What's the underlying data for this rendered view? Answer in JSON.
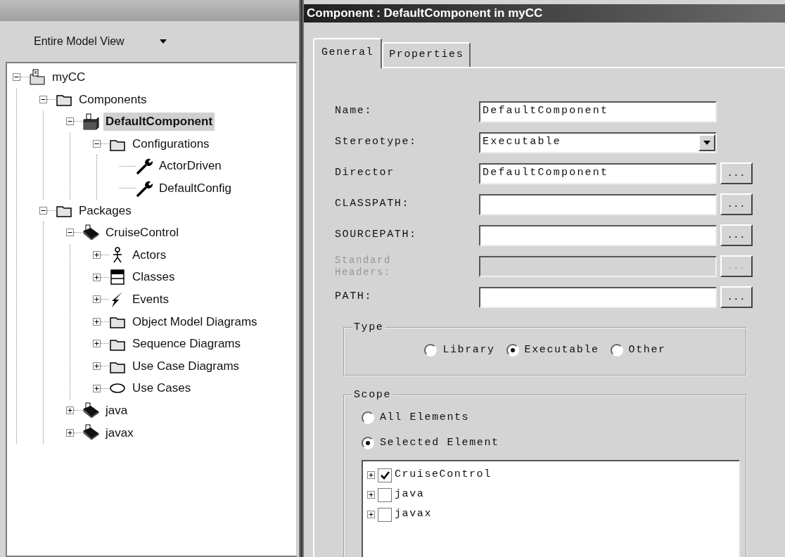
{
  "left_panel": {
    "view_selector": {
      "label": "Entire Model View"
    },
    "tree": [
      {
        "label": "myCC",
        "kind": "project",
        "expanded": true,
        "selected": false,
        "children": [
          {
            "label": "Components",
            "kind": "folder",
            "expanded": true,
            "selected": false,
            "children": [
              {
                "label": "DefaultComponent",
                "kind": "component",
                "expanded": true,
                "selected": true,
                "children": [
                  {
                    "label": "Configurations",
                    "kind": "folder",
                    "expanded": true,
                    "selected": false,
                    "children": [
                      {
                        "label": "ActorDriven",
                        "kind": "wrench",
                        "selected": false
                      },
                      {
                        "label": "DefaultConfig",
                        "kind": "wrench",
                        "selected": false
                      }
                    ]
                  }
                ]
              }
            ]
          },
          {
            "label": "Packages",
            "kind": "folder",
            "expanded": true,
            "selected": false,
            "children": [
              {
                "label": "CruiseControl",
                "kind": "book",
                "expanded": true,
                "selected": false,
                "children": [
                  {
                    "label": "Actors",
                    "kind": "actor",
                    "expanded": false,
                    "selected": false
                  },
                  {
                    "label": "Classes",
                    "kind": "class",
                    "expanded": false,
                    "selected": false
                  },
                  {
                    "label": "Events",
                    "kind": "event",
                    "expanded": false,
                    "selected": false
                  },
                  {
                    "label": "Object Model Diagrams",
                    "kind": "folder",
                    "expanded": false,
                    "selected": false
                  },
                  {
                    "label": "Sequence Diagrams",
                    "kind": "folder",
                    "expanded": false,
                    "selected": false
                  },
                  {
                    "label": "Use Case Diagrams",
                    "kind": "folder",
                    "expanded": false,
                    "selected": false
                  },
                  {
                    "label": "Use Cases",
                    "kind": "usecase",
                    "expanded": false,
                    "selected": false
                  }
                ]
              },
              {
                "label": "java",
                "kind": "book",
                "expanded": false,
                "selected": false
              },
              {
                "label": "javax",
                "kind": "book",
                "expanded": false,
                "selected": false
              }
            ]
          }
        ]
      }
    ]
  },
  "dialog": {
    "title": "Component : DefaultComponent in myCC",
    "tabs": [
      {
        "label": "General",
        "selected": true
      },
      {
        "label": "Properties",
        "selected": false
      }
    ],
    "fields": [
      {
        "label": "Name:",
        "kind": "text",
        "value": "DefaultComponent",
        "disabled": false
      },
      {
        "label": "Stereotype:",
        "kind": "dropdown",
        "value": "Executable",
        "disabled": false
      },
      {
        "label": "Director",
        "kind": "text",
        "value": "DefaultComponent",
        "disabled": false,
        "browse": "..."
      },
      {
        "label": "CLASSPATH:",
        "kind": "text",
        "disabled": false,
        "browse": "..."
      },
      {
        "label": "SOURCEPATH:",
        "kind": "text",
        "disabled": false,
        "browse": "..."
      },
      {
        "label": "Standard Headers:",
        "kind": "text",
        "disabled": true,
        "browse": "..."
      },
      {
        "label": "PATH:",
        "kind": "text",
        "disabled": false,
        "browse": "..."
      }
    ],
    "type_group": {
      "title": "Type",
      "options": [
        {
          "label": "Library",
          "selected": false
        },
        {
          "label": "Executable",
          "selected": true
        },
        {
          "label": "Other",
          "selected": false
        }
      ]
    },
    "scope_group": {
      "title": "Scope",
      "options": [
        {
          "label": "All Elements",
          "selected": false
        },
        {
          "label": "Selected Element",
          "selected": true
        }
      ],
      "tree": [
        {
          "label": "CruiseControl",
          "checked": true,
          "expanded": false
        },
        {
          "label": "java",
          "checked": false,
          "expanded": false
        },
        {
          "label": "javax",
          "checked": false,
          "expanded": false
        }
      ]
    }
  }
}
